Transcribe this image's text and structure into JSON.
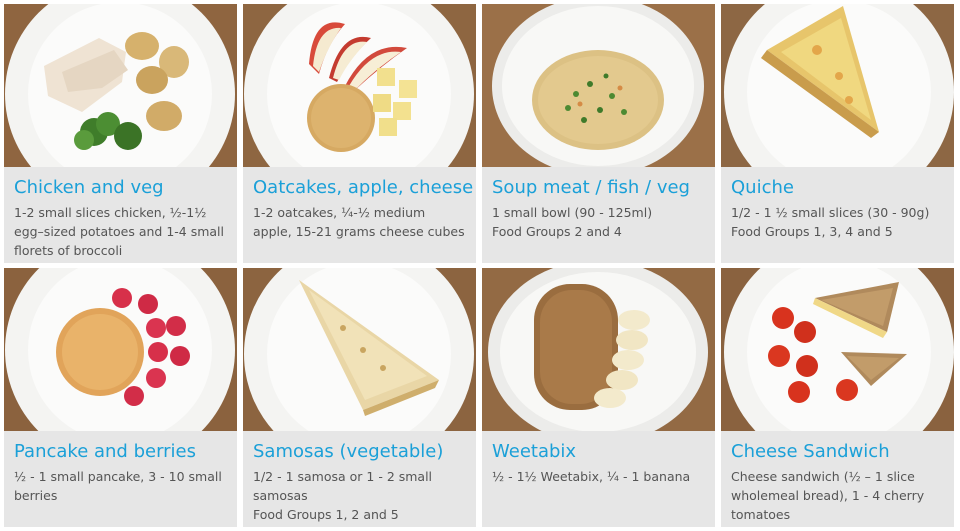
{
  "cards": [
    {
      "title": "Chicken and veg",
      "lines": [
        "1-2 small slices chicken, ½-1½ egg–sized potatoes and 1-4 small florets of broccoli"
      ]
    },
    {
      "title": "Oatcakes, apple, cheese",
      "lines": [
        "1-2 oatcakes, ¼-½ medium apple, 15-21 grams cheese cubes"
      ]
    },
    {
      "title": "Soup meat / fish / veg",
      "lines": [
        "1 small bowl (90 - 125ml)",
        "Food Groups 2 and 4"
      ]
    },
    {
      "title": "Quiche",
      "lines": [
        "1/2 - 1 ½ small slices (30 - 90g)",
        "Food Groups 1, 3, 4 and 5"
      ]
    },
    {
      "title": "Pancake and berries",
      "lines": [
        "½ - 1 small pancake, 3 - 10 small berries"
      ]
    },
    {
      "title": "Samosas (vegetable)",
      "lines": [
        "1/2 - 1 samosa or 1 - 2 small samosas",
        "Food Groups 1, 2 and 5"
      ]
    },
    {
      "title": "Weetabix",
      "lines": [
        "½ - 1½ Weetabix, ¼ - 1 banana"
      ]
    },
    {
      "title": "Cheese Sandwich",
      "lines": [
        "Cheese sandwich (½ – 1 slice wholemeal bread), 1 - 4 cherry tomatoes"
      ]
    }
  ]
}
